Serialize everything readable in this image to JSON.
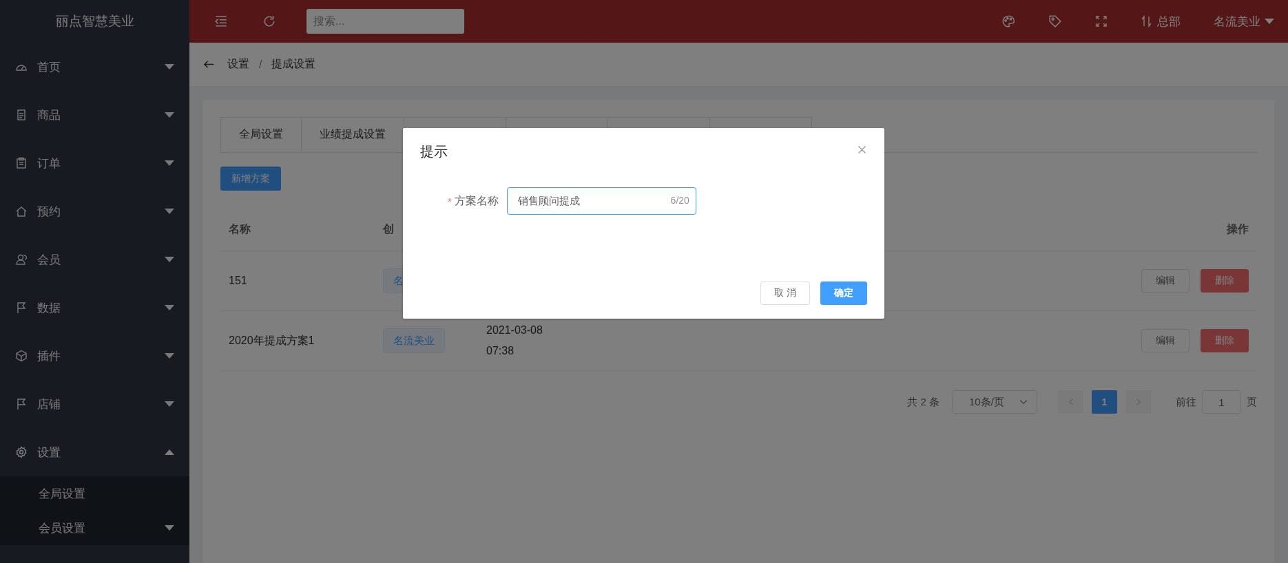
{
  "sidebar": {
    "logo": "丽点智慧美业",
    "items": [
      {
        "label": "首页",
        "expanded": false
      },
      {
        "label": "商品",
        "expanded": false
      },
      {
        "label": "订单",
        "expanded": false
      },
      {
        "label": "预约",
        "expanded": false
      },
      {
        "label": "会员",
        "expanded": false
      },
      {
        "label": "数据",
        "expanded": false
      },
      {
        "label": "插件",
        "expanded": false
      },
      {
        "label": "店铺",
        "expanded": false
      },
      {
        "label": "设置",
        "expanded": true,
        "children": [
          {
            "label": "全局设置",
            "kind": "link"
          },
          {
            "label": "会员设置",
            "kind": "group"
          }
        ]
      }
    ]
  },
  "topbar": {
    "search_placeholder": "搜索...",
    "org_switch": "总部",
    "store": "名流美业"
  },
  "breadcrumb": {
    "items": [
      "设置",
      "提成设置"
    ],
    "separator": "/"
  },
  "tabs": [
    {
      "label": "全局设置"
    },
    {
      "label": "业绩提成设置"
    }
  ],
  "add_button": "新增方案",
  "table": {
    "columns": [
      "名称",
      "创",
      "操作"
    ],
    "rows": [
      {
        "name": "151",
        "store": "名",
        "created": [],
        "actions": [
          "编辑",
          "删除"
        ]
      },
      {
        "name": "2020年提成方案1",
        "store": "名流美业",
        "created": [
          "2021-03-08",
          "07:38"
        ],
        "actions": [
          "编辑",
          "删除"
        ]
      }
    ]
  },
  "pagination": {
    "total": "共 2 条",
    "page_size": "10条/页",
    "pages": [
      {
        "label": "1",
        "selected": true
      }
    ],
    "jump_label": "前往",
    "jump_value": "1",
    "jump_suffix": "页"
  },
  "dialog": {
    "title": "提示",
    "field": {
      "required_mark": "*",
      "label": "方案名称",
      "value": "销售顾问提成",
      "counter": "6/20",
      "focused": true
    },
    "buttons": [
      {
        "label": "取 消",
        "kind": "default"
      },
      {
        "label": "确定",
        "kind": "primary"
      }
    ]
  }
}
